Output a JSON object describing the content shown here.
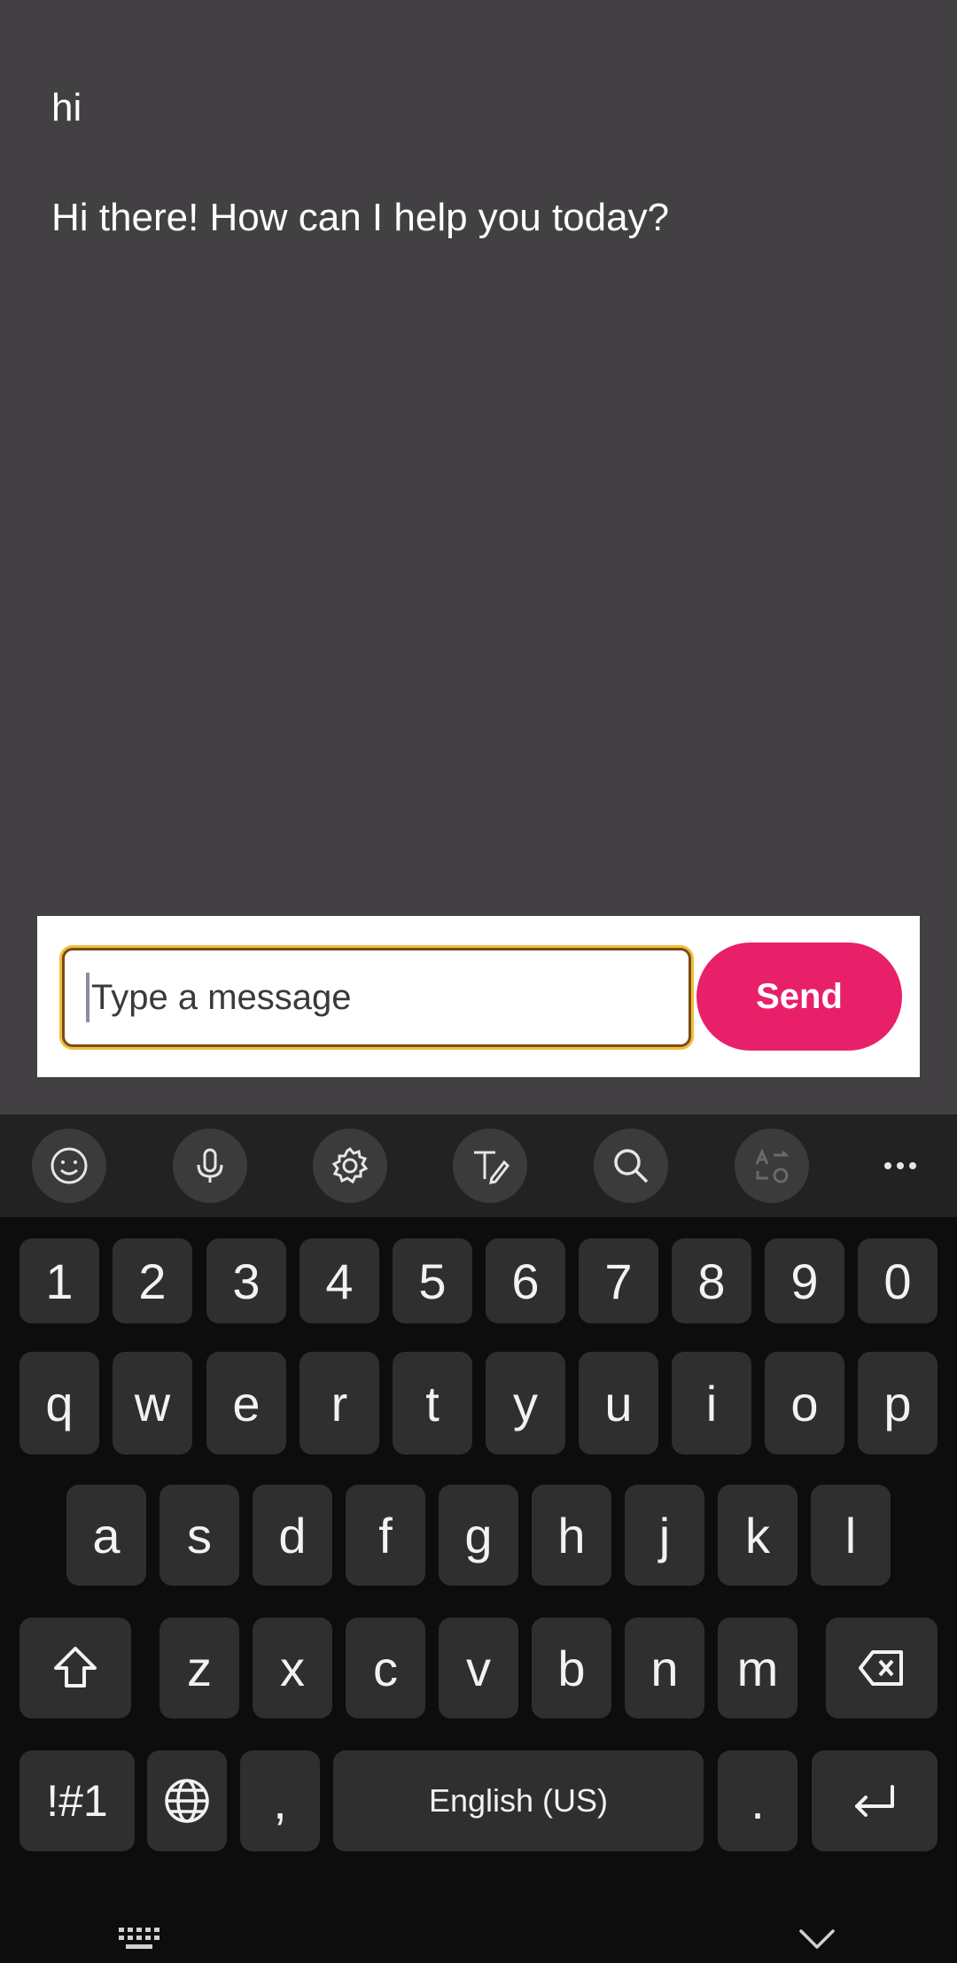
{
  "chat": {
    "messages": [
      {
        "role": "user",
        "text": "hi"
      },
      {
        "role": "assistant",
        "text": "Hi there! How can I help you today?"
      }
    ]
  },
  "composer": {
    "placeholder": "Type a message",
    "value": "",
    "send_label": "Send"
  },
  "keyboard_toolbar": {
    "icons": [
      "emoji-icon",
      "microphone-icon",
      "settings-icon",
      "handwriting-icon",
      "search-icon",
      "translate-icon",
      "more-icon"
    ]
  },
  "keyboard": {
    "row_numbers": [
      "1",
      "2",
      "3",
      "4",
      "5",
      "6",
      "7",
      "8",
      "9",
      "0"
    ],
    "row_1": [
      "q",
      "w",
      "e",
      "r",
      "t",
      "y",
      "u",
      "i",
      "o",
      "p"
    ],
    "row_2": [
      "a",
      "s",
      "d",
      "f",
      "g",
      "h",
      "j",
      "k",
      "l"
    ],
    "row_3": [
      "z",
      "x",
      "c",
      "v",
      "b",
      "n",
      "m"
    ],
    "symbols_label": "!#1",
    "comma_label": ",",
    "space_label": "English (US)",
    "period_label": "."
  },
  "colors": {
    "chat_background": "#424043",
    "send_button": "#e8206a",
    "input_focus_ring": "#f2be3e",
    "keyboard_background": "#0d0d0d",
    "key_background": "#2f2f2f"
  }
}
